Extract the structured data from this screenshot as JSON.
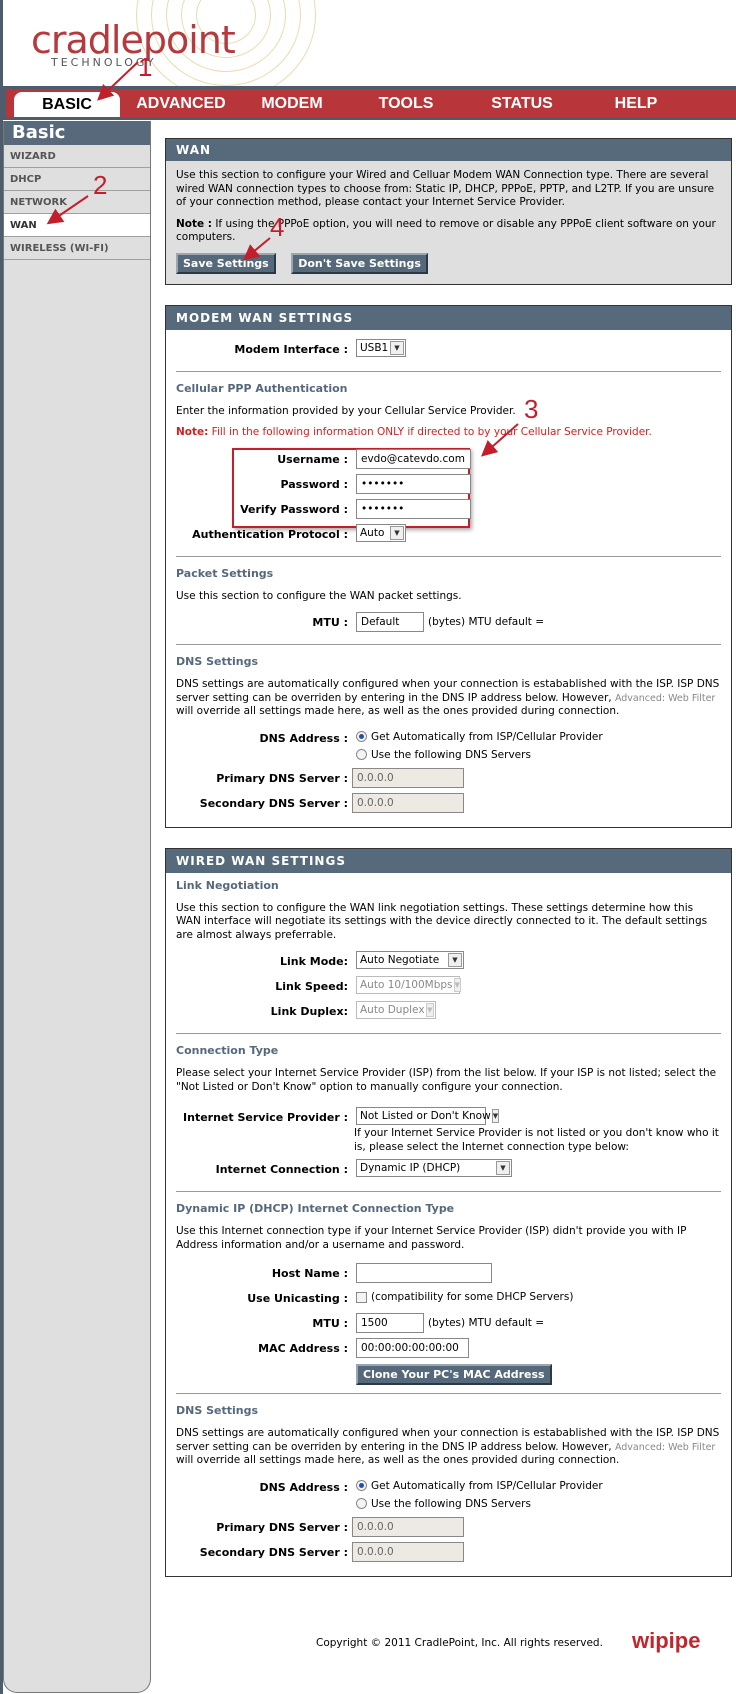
{
  "brand": {
    "logo_text": "cradlepoint",
    "logo_sub": "TECHNOLOGY",
    "footer_logo": "wipipe"
  },
  "topnav": {
    "tabs": [
      {
        "label": "BASIC",
        "active": true
      },
      {
        "label": "ADVANCED"
      },
      {
        "label": "MODEM"
      },
      {
        "label": "TOOLS"
      },
      {
        "label": "STATUS"
      },
      {
        "label": "HELP"
      }
    ]
  },
  "sidebar": {
    "title": "Basic",
    "items": [
      {
        "label": "WIZARD"
      },
      {
        "label": "DHCP"
      },
      {
        "label": "NETWORK"
      },
      {
        "label": "WAN",
        "active": true
      },
      {
        "label": "WIRELESS (WI-FI)"
      }
    ]
  },
  "annotations": [
    "1",
    "2",
    "3",
    "4"
  ],
  "wan": {
    "title": "WAN",
    "desc": "Use this section to configure your Wired and Celluar Modem WAN Connection type. There are several wired WAN connection types to choose from: Static IP, DHCP, PPPoE, PPTP, and L2TP. If you are unsure of your connection method, please contact your Internet Service Provider.",
    "note_label": "Note :",
    "note_text": " If using the PPPoE option, you will need to remove or disable any PPPoE client software on your computers.",
    "save_label": "Save Settings",
    "dont_save_label": "Don't Save Settings"
  },
  "modem": {
    "title": "MODEM WAN SETTINGS",
    "interface_label": "Modem Interface :",
    "interface_value": "USB1",
    "ppp_head": "Cellular PPP Authentication",
    "ppp_desc": "Enter the information provided by your Cellular Service Provider.",
    "ppp_note_label": "Note:",
    "ppp_note_text": " Fill in the following information ONLY if directed to by your Cellular Service Provider.",
    "username_label": "Username :",
    "username_value": "evdo@catevdo.com",
    "password_label": "Password :",
    "password_value": "•••••••",
    "verify_label": "Verify Password :",
    "verify_value": "•••••••",
    "auth_label": "Authentication Protocol :",
    "auth_value": "Auto",
    "packet_head": "Packet Settings",
    "packet_desc": "Use this section to configure the WAN packet settings.",
    "mtu_label": "MTU :",
    "mtu_value": "Default",
    "mtu_after": "(bytes) MTU default =",
    "dns_head": "DNS Settings",
    "dns_desc_1": "DNS settings are automatically configured when your connection is estabablished with the ISP. ISP DNS server setting can be overriden by entering in the DNS IP address below. However, ",
    "dns_link": "Advanced: Web Filter",
    "dns_desc_2": " will override all settings made here, as well as the ones provided during connection.",
    "dns_addr_label": "DNS Address :",
    "dns_opt_auto": "Get Automatically from ISP/Cellular Provider",
    "dns_opt_manual": "Use the following DNS Servers",
    "primary_label": "Primary DNS Server :",
    "primary_value": "0.0.0.0",
    "secondary_label": "Secondary DNS Server :",
    "secondary_value": "0.0.0.0"
  },
  "wired": {
    "title": "WIRED WAN SETTINGS",
    "link_head": "Link Negotiation",
    "link_desc": "Use this section to configure the WAN link negotiation settings. These settings determine how this WAN interface will negotiate its settings with the device directly connected to it. The default settings are almost always preferrable.",
    "link_mode_label": "Link Mode:",
    "link_mode_value": "Auto Negotiate",
    "link_speed_label": "Link Speed:",
    "link_speed_value": "Auto 10/100Mbps",
    "link_duplex_label": "Link Duplex:",
    "link_duplex_value": "Auto Duplex",
    "conn_head": "Connection Type",
    "conn_desc": "Please select your Internet Service Provider (ISP) from the list below. If your ISP is not listed; select the \"Not Listed or Don't Know\" option to manually configure your connection.",
    "isp_label": "Internet Service Provider :",
    "isp_value": "Not Listed or Don't Know",
    "isp_hint": "If your Internet Service Provider is not listed or you don't know who it is, please select the Internet connection type below:",
    "conn_label": "Internet Connection :",
    "conn_value": "Dynamic IP (DHCP)",
    "dhcp_head": "Dynamic IP (DHCP) Internet Connection Type",
    "dhcp_desc": "Use this Internet connection type if your Internet Service Provider (ISP) didn't provide you with IP Address information and/or a username and password.",
    "host_label": "Host Name :",
    "host_value": "",
    "unicast_label": "Use Unicasting :",
    "unicast_after": "(compatibility for some DHCP Servers)",
    "mtu_label": "MTU :",
    "mtu_value": "1500",
    "mtu_after": "(bytes) MTU default =",
    "mac_label": "MAC Address :",
    "mac_value": "00:00:00:00:00:00",
    "clone_label": "Clone Your PC's MAC Address",
    "dns_head": "DNS Settings",
    "dns_desc_1": "DNS settings are automatically configured when your connection is estabablished with the ISP. ISP DNS server setting can be overriden by entering in the DNS IP address below. However, ",
    "dns_link": "Advanced: Web Filter",
    "dns_desc_2": " will override all settings made here, as well as the ones provided during connection.",
    "dns_addr_label": "DNS Address :",
    "dns_opt_auto": "Get Automatically from ISP/Cellular Provider",
    "dns_opt_manual": "Use the following DNS Servers",
    "primary_label": "Primary DNS Server :",
    "primary_value": "0.0.0.0",
    "secondary_label": "Secondary DNS Server :",
    "secondary_value": "0.0.0.0"
  },
  "footer": {
    "copyright": "Copyright © 2011 CradlePoint, Inc. All rights reserved."
  }
}
